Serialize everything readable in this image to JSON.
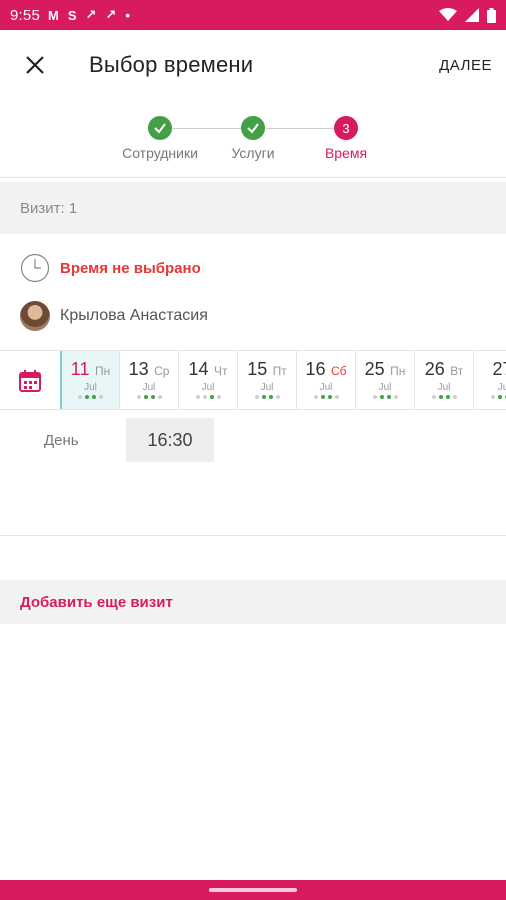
{
  "status_bar": {
    "time": "9:55",
    "icons": [
      "gmail-icon",
      "s-app-icon",
      "missed-call-icon",
      "missed-call-icon",
      "dot-icon"
    ],
    "right_icons": [
      "wifi-icon",
      "signal-icon",
      "battery-icon"
    ]
  },
  "app_bar": {
    "title": "Выбор времени",
    "next_label": "ДАЛЕЕ"
  },
  "stepper": {
    "steps": [
      {
        "label": "Сотрудники",
        "state": "done"
      },
      {
        "label": "Услуги",
        "state": "done"
      },
      {
        "label": "Время",
        "number": "3",
        "state": "active"
      }
    ]
  },
  "visit": {
    "header": "Визит: 1",
    "time_status": "Время не выбрано",
    "employee_name": "Крылова Анастасия"
  },
  "dates": [
    {
      "num": "11",
      "wd": "Пн",
      "mon": "Jul",
      "selected": true
    },
    {
      "num": "13",
      "wd": "Ср",
      "mon": "Jul"
    },
    {
      "num": "14",
      "wd": "Чт",
      "mon": "Jul"
    },
    {
      "num": "15",
      "wd": "Пт",
      "mon": "Jul"
    },
    {
      "num": "16",
      "wd": "Сб",
      "mon": "Jul",
      "weekend": true
    },
    {
      "num": "25",
      "wd": "Пн",
      "mon": "Jul"
    },
    {
      "num": "26",
      "wd": "Вт",
      "mon": "Jul"
    },
    {
      "num": "27",
      "wd": "",
      "mon": "Ju"
    }
  ],
  "slots": {
    "period_label": "День",
    "times": [
      "16:30"
    ]
  },
  "add_visit_label": "Добавить еще визит",
  "colors": {
    "accent": "#d81b60",
    "success": "#43a047",
    "error": "#e53935"
  }
}
